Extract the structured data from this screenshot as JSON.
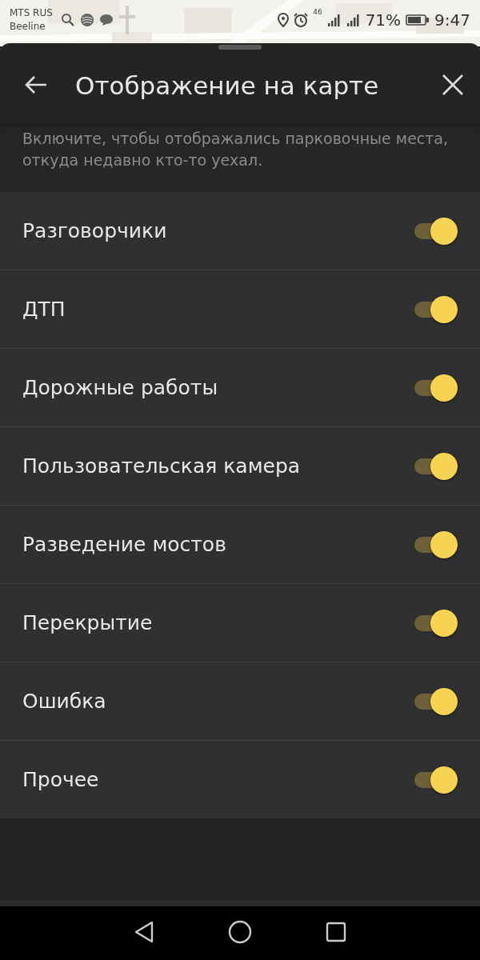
{
  "status_bar": {
    "carrier_1": "MTS RUS",
    "carrier_2": "Beeline",
    "network": "46",
    "battery": "71%",
    "time": "9:47"
  },
  "sheet": {
    "title": "Отображение на карте",
    "description": "Включите, чтобы отображались парковочные места, откуда недавно кто-то уехал.",
    "items": [
      {
        "label": "Разговорчики",
        "on": true
      },
      {
        "label": "ДТП",
        "on": true
      },
      {
        "label": "Дорожные работы",
        "on": true
      },
      {
        "label": "Пользовательская камера",
        "on": true
      },
      {
        "label": "Разведение мостов",
        "on": true
      },
      {
        "label": "Перекрытие",
        "on": true
      },
      {
        "label": "Ошибка",
        "on": true
      },
      {
        "label": "Прочее",
        "on": true
      }
    ]
  }
}
